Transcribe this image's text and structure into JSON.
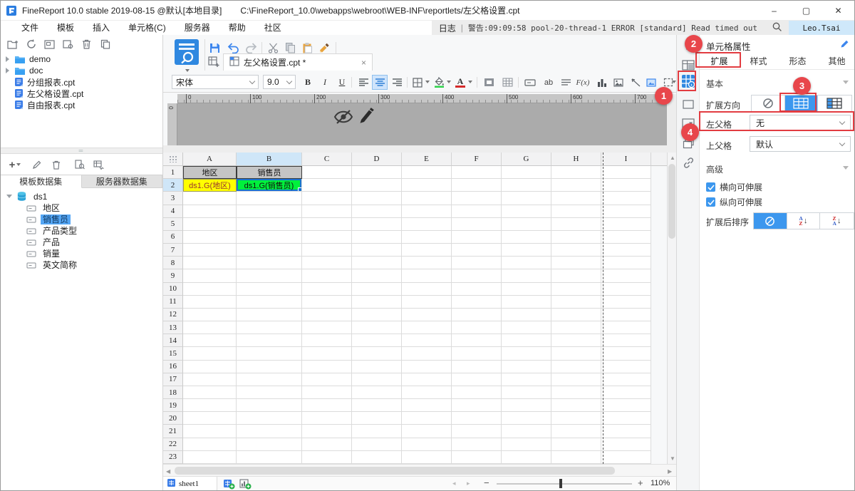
{
  "titlebar": {
    "app_title": "FineReport 10.0 stable 2019-08-15 @默认[本地目录]",
    "file_path": "C:\\FineReport_10.0\\webapps\\webroot\\WEB-INF\\reportlets/左父格设置.cpt",
    "minimize": "–",
    "maximize": "▢",
    "close": "✕"
  },
  "menubar": {
    "items": [
      "文件",
      "模板",
      "插入",
      "单元格(C)",
      "服务器",
      "帮助",
      "社区"
    ],
    "log_label": "日志",
    "divider": "|",
    "warning": "警告:09:09:58 pool-20-thread-1 ERROR [standard] Read timed out",
    "user": "Leo.Tsai"
  },
  "file_panel": {
    "items": [
      {
        "label": "demo",
        "type": "folder"
      },
      {
        "label": "doc",
        "type": "folder"
      },
      {
        "label": "分组报表.cpt",
        "type": "file"
      },
      {
        "label": "左父格设置.cpt",
        "type": "file"
      },
      {
        "label": "自由报表.cpt",
        "type": "file"
      }
    ]
  },
  "dataset_panel": {
    "tabs": [
      "模板数据集",
      "服务器数据集"
    ],
    "active_tab": "模板数据集",
    "root_label": "ds1",
    "fields": [
      "地区",
      "销售员",
      "产品类型",
      "产品",
      "销量",
      "英文简称"
    ],
    "selected_field": "销售员"
  },
  "document_tabs": {
    "active": "左父格设置.cpt *",
    "close": "×"
  },
  "format_toolbar": {
    "font": "宋体",
    "size": "9.0",
    "bold": "B",
    "italic": "I",
    "underline": "U",
    "ab": "ab",
    "fx": "F(x)",
    "color_letter": "A"
  },
  "ruler": {
    "ticks": [
      "0",
      "100",
      "200",
      "300",
      "400",
      "500",
      "600",
      "700"
    ],
    "vertical_origin": "0"
  },
  "sheet": {
    "columns": [
      "A",
      "B",
      "C",
      "D",
      "E",
      "F",
      "G",
      "H",
      "I"
    ],
    "selected_column": "B",
    "row_count": 23,
    "selected_row": 2,
    "cells": [
      {
        "ref": "A1",
        "text": "地区",
        "style": "header"
      },
      {
        "ref": "B1",
        "text": "销售员",
        "style": "header"
      },
      {
        "ref": "A2",
        "text": "ds1.G(地区)",
        "style": "yellow"
      },
      {
        "ref": "B2",
        "text": "ds1.G(销售员)",
        "style": "green",
        "selected": true
      }
    ]
  },
  "sheet_bar": {
    "sheet_name": "sheet1",
    "zoom": "110%",
    "zoom_minus": "−",
    "zoom_plus": "+",
    "pager_prev": "◂",
    "pager_next": "▸"
  },
  "cell_properties": {
    "title": "单元格属性",
    "tabs": [
      "扩展",
      "样式",
      "形态",
      "其他"
    ],
    "active_tab": "扩展",
    "basic_label": "基本",
    "expand_direction_label": "扩展方向",
    "left_parent_label": "左父格",
    "left_parent_value": "无",
    "up_parent_label": "上父格",
    "up_parent_value": "默认",
    "advanced_label": "高级",
    "h_expand_label": "横向可伸展",
    "v_expand_label": "纵向可伸展",
    "sort_label": "扩展后排序",
    "sort_a": "A",
    "sort_z": "Z"
  },
  "annotations": {
    "n1": "1",
    "n2": "2",
    "n3": "3",
    "n4": "4"
  },
  "colors": {
    "accent_blue": "#3c97ee",
    "annotation_red": "#e8464b",
    "cell_yellow": "#ffff00",
    "cell_green": "#00f03c",
    "header_gray": "#c5c5c5",
    "canvas_gray": "#ababab",
    "user_chip": "#cfe8fa"
  }
}
